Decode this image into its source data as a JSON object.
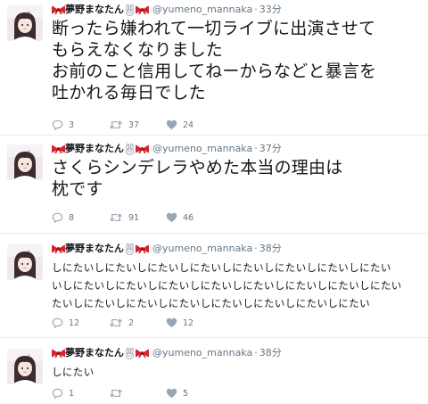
{
  "tweets": [
    {
      "display_name": "夢野まなたん",
      "handle": "@yumeno_mannaka",
      "separator": "·",
      "time": "33分",
      "text_lines": [
        "断ったら嫌われて一切ライブに出演させて",
        "もらえなくなりました",
        "お前のこと信用してねーからなどと暴言を",
        "吐かれる毎日でした"
      ],
      "counts": {
        "reply": "3",
        "retweet": "37",
        "like": "24"
      }
    },
    {
      "display_name": "夢野まなたん",
      "handle": "@yumeno_mannaka",
      "separator": "·",
      "time": "37分",
      "text_lines": [
        "さくらシンデレラやめた本当の理由は",
        "枕です"
      ],
      "counts": {
        "reply": "8",
        "retweet": "91",
        "like": "46"
      }
    },
    {
      "display_name": "夢野まなたん",
      "handle": "@yumeno_mannaka",
      "separator": "·",
      "time": "38分",
      "text_lines": [
        "しにたいしにたいしにたいしにたいしにたいしにたいしにたいしにたい",
        "いしにたいしにたいしにたいしにたいしにたいしにたいしにたいしにたい",
        "たいしにたいしにたいしにたいしにたいしにたいしにたいしにたい"
      ],
      "counts": {
        "reply": "12",
        "retweet": "2",
        "like": "12"
      }
    },
    {
      "display_name": "夢野まなたん",
      "handle": "@yumeno_mannaka",
      "separator": "·",
      "time": "38分",
      "text_lines": [
        "しにたい"
      ],
      "counts": {
        "reply": "1",
        "retweet": "",
        "like": "5"
      }
    }
  ],
  "icons": {
    "name_decorations": [
      "ribbon-icon",
      "rabbit-icon",
      "ribbon-icon"
    ],
    "actions": [
      "reply-icon",
      "retweet-icon",
      "like-icon"
    ]
  },
  "colors": {
    "text": "#14171a",
    "secondary": "#657786",
    "ribbon": "#d9232e",
    "divider": "#e6ecf0"
  }
}
